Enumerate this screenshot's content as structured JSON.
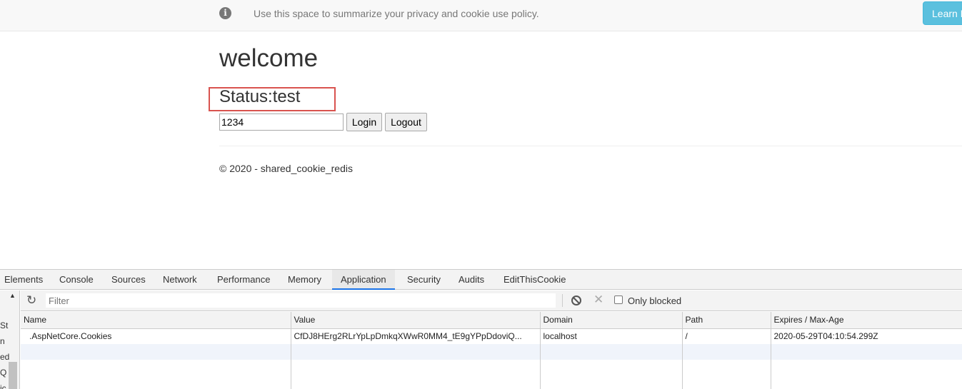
{
  "banner": {
    "text": "Use this space to summarize your privacy and cookie use policy.",
    "button_label": "Learn More",
    "icon": "info-icon",
    "accent": "#5bc0de"
  },
  "main": {
    "heading": "welcome",
    "status": "Status:test",
    "input_value": "1234",
    "login_label": "Login",
    "logout_label": "Logout",
    "footer": "© 2020 - shared_cookie_redis",
    "highlight_color": "#d9534f"
  },
  "devtools": {
    "tabs": [
      "Elements",
      "Console",
      "Sources",
      "Network",
      "Performance",
      "Memory",
      "Application",
      "Security",
      "Audits",
      "EditThisCookie"
    ],
    "active_tab": "Application",
    "sidebar_fragments": [
      "St",
      "n",
      "ed",
      "Q",
      "ic"
    ],
    "filter_placeholder": "Filter",
    "only_blocked_label": "Only blocked",
    "columns": [
      "Name",
      "Value",
      "Domain",
      "Path",
      "Expires / Max-Age"
    ],
    "rows": [
      {
        "name": ".AspNetCore.Cookies",
        "value": "CfDJ8HErg2RLrYpLpDmkqXWwR0MM4_tE9gYPpDdoviQ...",
        "domain": "localhost",
        "path": "/",
        "expires": "2020-05-29T04:10:54.299Z"
      }
    ]
  }
}
